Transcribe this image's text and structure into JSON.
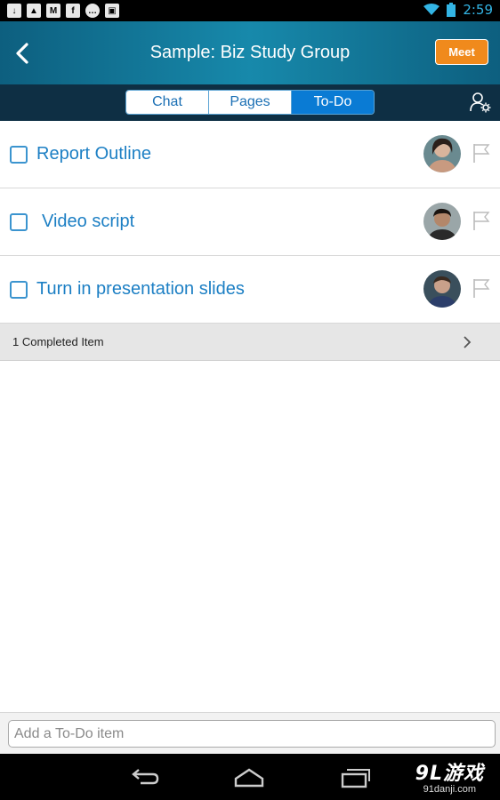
{
  "status_bar": {
    "time": "2:59",
    "left_icons": [
      "download-icon",
      "image-icon",
      "gmail-icon",
      "facebook-icon",
      "chat-icon",
      "briefcase-icon"
    ],
    "right_icons": [
      "wifi-icon",
      "battery-icon"
    ]
  },
  "header": {
    "title": "Sample: Biz Study Group",
    "meet_label": "Meet",
    "accent_color": "#f08a1c"
  },
  "tabs": [
    {
      "label": "Chat",
      "active": false
    },
    {
      "label": "Pages",
      "active": false
    },
    {
      "label": "To-Do",
      "active": true
    }
  ],
  "todos": [
    {
      "label": "Report Outline"
    },
    {
      "label": "Video script"
    },
    {
      "label": "Turn in presentation slides"
    }
  ],
  "completed": {
    "label": "1 Completed Item"
  },
  "add_item": {
    "placeholder": "Add a To-Do item"
  },
  "watermark": {
    "brand": "9L游戏",
    "url": "91danji.com"
  }
}
